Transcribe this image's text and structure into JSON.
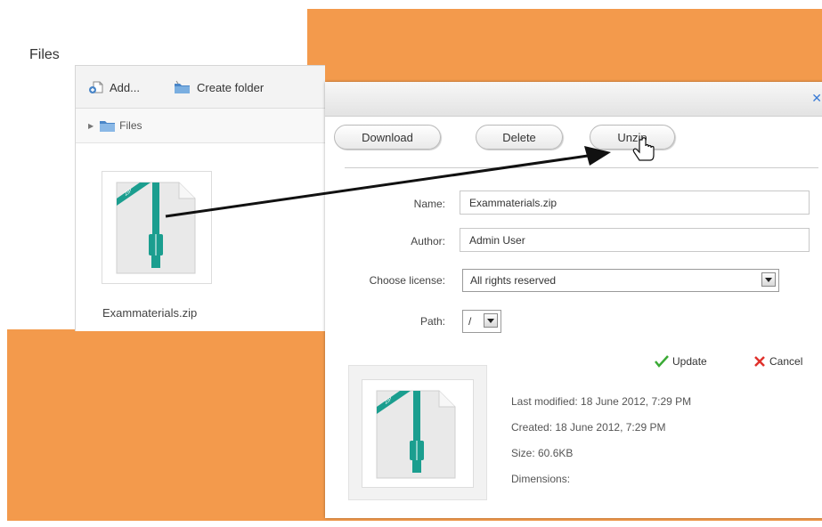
{
  "file_manager": {
    "title": "Files",
    "toolbar": {
      "add_label": "Add...",
      "create_folder_label": "Create folder"
    },
    "path": {
      "label": "Files"
    },
    "file": {
      "name": "Exammaterials.zip",
      "icon": "zip-file-icon"
    }
  },
  "dialog": {
    "buttons": {
      "download": "Download",
      "delete": "Delete",
      "unzip": "Unzip"
    },
    "form": {
      "name_label": "Name:",
      "name_value": "Exammaterials.zip",
      "author_label": "Author:",
      "author_value": "Admin User",
      "license_label": "Choose license:",
      "license_value": "All rights reserved",
      "path_label": "Path:",
      "path_value": "/"
    },
    "actions": {
      "update": "Update",
      "cancel": "Cancel"
    },
    "info": {
      "last_modified": "Last modified: 18 June 2012, 7:29 PM",
      "created": "Created: 18 June 2012, 7:29 PM",
      "size": "Size: 60.6KB",
      "dimensions": "Dimensions:"
    }
  },
  "colors": {
    "background_accent": "#f39a4c",
    "zip_teal": "#1b9e8f",
    "update_green": "#3aaa35",
    "cancel_red": "#e0312b",
    "folder_blue": "#4a86c8"
  }
}
